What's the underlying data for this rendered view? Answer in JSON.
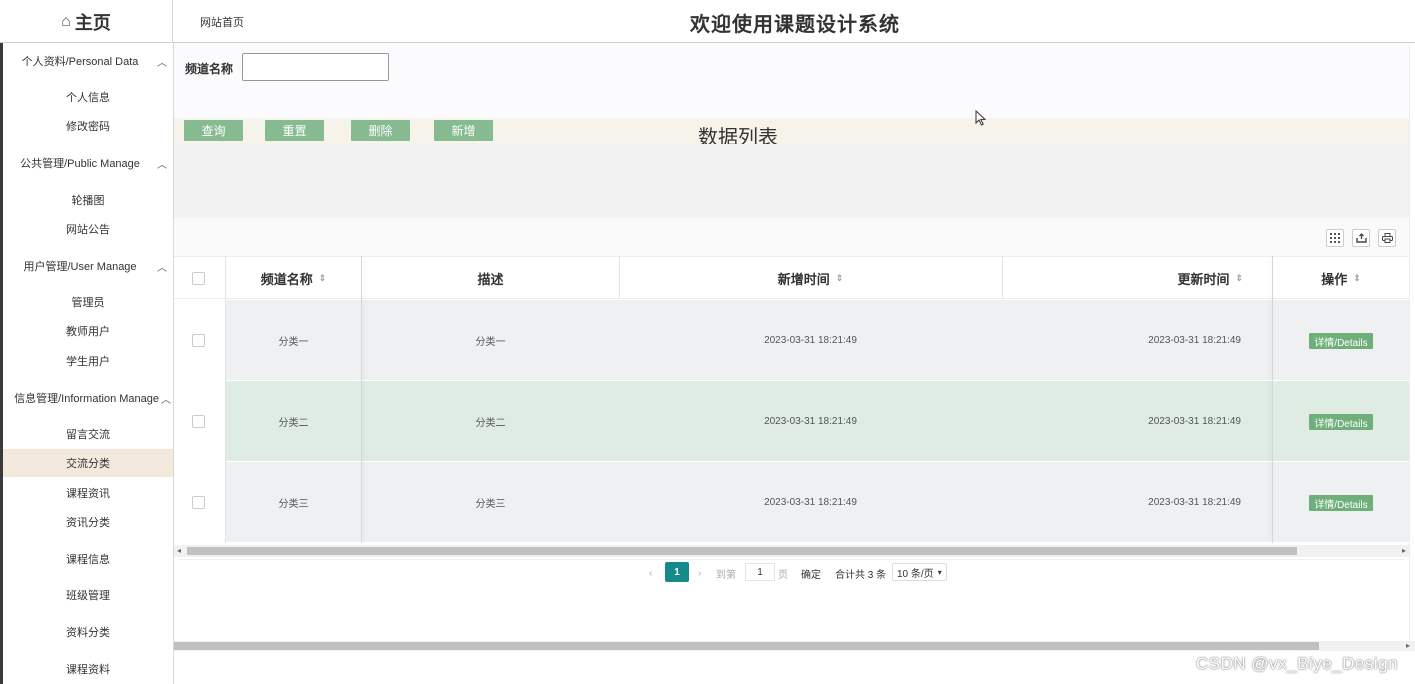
{
  "header": {
    "home_label": "主页",
    "site_link": "网站首页",
    "system_title": "欢迎使用课题设计系统"
  },
  "sidebar": {
    "groups": [
      {
        "title": "个人资料/Personal Data",
        "items": [
          "个人信息",
          "修改密码"
        ]
      },
      {
        "title": "公共管理/Public Manage",
        "items": [
          "轮播图",
          "网站公告"
        ]
      },
      {
        "title": "用户管理/User Manage",
        "items": [
          "管理员",
          "教师用户",
          "学生用户"
        ]
      },
      {
        "title": "信息管理/Information Manage",
        "items": [
          "留言交流",
          "交流分类",
          "课程资讯",
          "资讯分类",
          "课程信息",
          "班级管理",
          "资料分类",
          "课程资料"
        ]
      }
    ],
    "active_item": "交流分类"
  },
  "search": {
    "label": "频道名称",
    "value": ""
  },
  "buttons": {
    "query": "查询",
    "reset": "重置",
    "delete": "删除",
    "add": "新增"
  },
  "list_title": "数据列表",
  "table": {
    "columns": [
      "频道名称",
      "描述",
      "新增时间",
      "更新时间",
      "操作"
    ],
    "rows": [
      {
        "name": "分类一",
        "desc": "分类一",
        "created": "2023-03-31 18:21:49",
        "updated": "2023-03-31 18:21:49",
        "action": "详情/Details"
      },
      {
        "name": "分类二",
        "desc": "分类二",
        "created": "2023-03-31 18:21:49",
        "updated": "2023-03-31 18:21:49",
        "action": "详情/Details"
      },
      {
        "name": "分类三",
        "desc": "分类三",
        "created": "2023-03-31 18:21:49",
        "updated": "2023-03-31 18:21:49",
        "action": "详情/Details"
      }
    ]
  },
  "pagination": {
    "current_page": "1",
    "goto_label": "到第",
    "goto_value": "1",
    "page_unit": "页",
    "confirm": "确定",
    "total": "合计共 3 条",
    "page_size": "10 条/页"
  },
  "watermark": "CSDN @vx_Biye_Design",
  "colors": {
    "button_green": "#86ba91",
    "detail_green": "#6fb07a",
    "active_sidebar": "#f2e9dc",
    "highlight_row": "#deece4",
    "odd_row": "#eff0f1",
    "pager_active": "#168a8a"
  }
}
